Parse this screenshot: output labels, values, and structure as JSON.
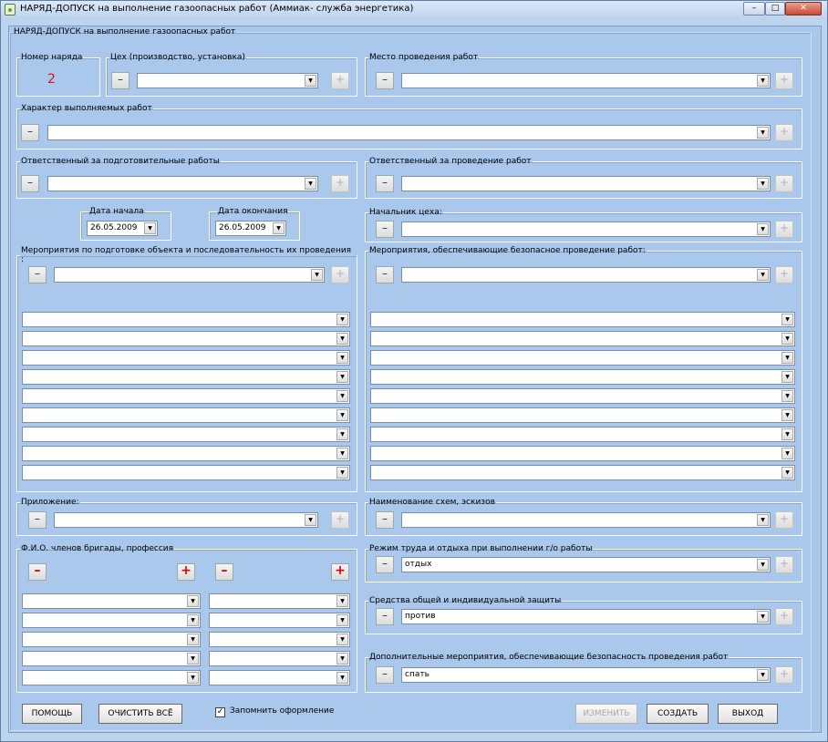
{
  "window": {
    "title": "НАРЯД-ДОПУСК на выполнение газоопасных работ (Аммиак- служба энергетика)",
    "min": "–",
    "max": "□",
    "close": "✕"
  },
  "main_group": "НАРЯД-ДОПУСК на выполнение газоопасных работ",
  "order": {
    "label": "Номер наряда",
    "value": "2"
  },
  "workshop": {
    "label": "Цех (производство, установка)"
  },
  "place": {
    "label": "Место проведения работ"
  },
  "character": {
    "label": "Характер выполняемых работ"
  },
  "resp_prep": {
    "label": "Ответственный за подготовительные работы"
  },
  "resp_work": {
    "label": "Ответственный за проведение работ"
  },
  "date_start": {
    "label": "Дата начала",
    "value": "26.05.2009"
  },
  "date_end": {
    "label": "Дата окончания",
    "value": "26.05.2009"
  },
  "chief": {
    "label": "Начальник цеха:"
  },
  "measures_prep": {
    "label": "Мероприятия по подготовке объекта и последовательность их проведения :"
  },
  "measures_safe": {
    "label": "Мероприятия, обеспечивающие безопасное проведение работ:"
  },
  "appendix": {
    "label": "Приложение:"
  },
  "schemes": {
    "label": "Наименование схем, эскизов"
  },
  "brigade": {
    "label": "Ф.И.О. членов бригады, профессия"
  },
  "regime": {
    "label": "Режим труда и отдыха при выполнении г/о работы",
    "value": "отдых"
  },
  "protection": {
    "label": "Средства общей и индивидуальной защиты",
    "value": "против"
  },
  "extra": {
    "label": "Дополнительные мероприятия, обеспечивающие безопасность проведения работ",
    "value": "спать"
  },
  "symbols": {
    "minus": "–",
    "plus": "+",
    "arrow": "▼",
    "check": "✓"
  },
  "buttons": {
    "help": "ПОМОЩЬ",
    "clear": "ОЧИСТИТЬ ВСЁ",
    "change": "ИЗМЕНИТЬ",
    "create": "СОЗДАТЬ",
    "exit": "ВЫХОД"
  },
  "remember": {
    "label": "Запомнить оформление",
    "checked": true
  }
}
